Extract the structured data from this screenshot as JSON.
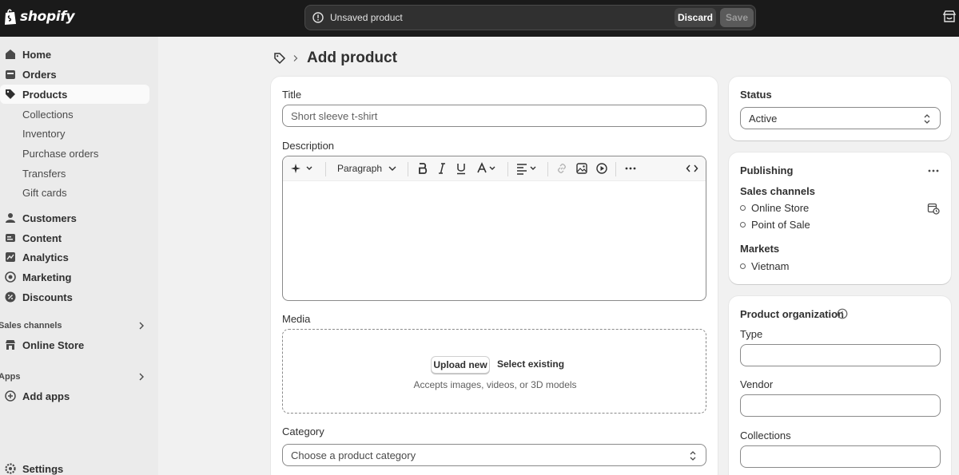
{
  "topbar": {
    "logo_text": "shopify",
    "unsaved_text": "Unsaved product",
    "discard_label": "Discard",
    "save_label": "Save"
  },
  "sidebar": {
    "items": [
      {
        "label": "Home",
        "icon": "home-icon"
      },
      {
        "label": "Orders",
        "icon": "orders-icon"
      },
      {
        "label": "Products",
        "icon": "tag-icon",
        "active": true
      },
      {
        "label": "Collections",
        "sub": true
      },
      {
        "label": "Inventory",
        "sub": true
      },
      {
        "label": "Purchase orders",
        "sub": true
      },
      {
        "label": "Transfers",
        "sub": true
      },
      {
        "label": "Gift cards",
        "sub": true
      },
      {
        "label": "Customers",
        "icon": "person-icon"
      },
      {
        "label": "Content",
        "icon": "content-icon"
      },
      {
        "label": "Analytics",
        "icon": "analytics-icon"
      },
      {
        "label": "Marketing",
        "icon": "target-icon"
      },
      {
        "label": "Discounts",
        "icon": "discount-icon"
      }
    ],
    "sales_channels_heading": "Sales channels",
    "online_store_label": "Online Store",
    "apps_heading": "Apps",
    "add_apps_label": "Add apps",
    "settings_label": "Settings"
  },
  "page": {
    "title": "Add product"
  },
  "product": {
    "title_label": "Title",
    "title_placeholder": "Short sleeve t-shirt",
    "description_label": "Description",
    "paragraph_label": "Paragraph",
    "media_label": "Media",
    "upload_label": "Upload new",
    "select_existing_label": "Select existing",
    "media_note": "Accepts images, videos, or 3D models",
    "category_label": "Category",
    "category_placeholder": "Choose a product category"
  },
  "status": {
    "heading": "Status",
    "value": "Active"
  },
  "publishing": {
    "heading": "Publishing",
    "sales_channels_label": "Sales channels",
    "channels": [
      "Online Store",
      "Point of Sale"
    ],
    "markets_label": "Markets",
    "markets": [
      "Vietnam"
    ]
  },
  "organization": {
    "heading": "Product organization",
    "type_label": "Type",
    "vendor_label": "Vendor",
    "collections_label": "Collections"
  },
  "colors": {
    "topbar": "#1a1a1a",
    "background": "#f1f1f1",
    "card": "#ffffff"
  }
}
